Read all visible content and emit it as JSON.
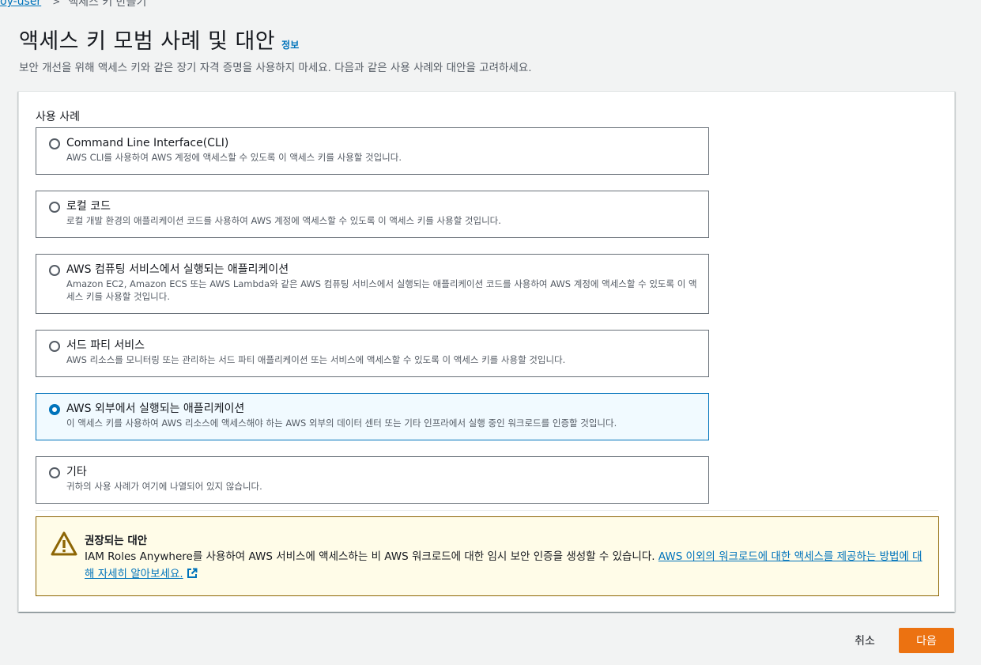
{
  "breadcrumb": {
    "user_link": "oy-user",
    "separator": ">",
    "current": "액세스 키 만들기"
  },
  "header": {
    "title": "액세스 키 모범 사례 및 대안",
    "info_link": "정보",
    "description": "보안 개선을 위해 액세스 키와 같은 장기 자격 증명을 사용하지 마세요. 다음과 같은 사용 사례와 대안을 고려하세요."
  },
  "use_cases": {
    "label": "사용 사례",
    "selected_index": 4,
    "options": [
      {
        "title": "Command Line Interface(CLI)",
        "description": "AWS CLI를 사용하여 AWS 계정에 액세스할 수 있도록 이 액세스 키를 사용할 것입니다."
      },
      {
        "title": "로컬 코드",
        "description": "로컬 개발 환경의 애플리케이션 코드를 사용하여 AWS 계정에 액세스할 수 있도록 이 액세스 키를 사용할 것입니다."
      },
      {
        "title": "AWS 컴퓨팅 서비스에서 실행되는 애플리케이션",
        "description": "Amazon EC2, Amazon ECS 또는 AWS Lambda와 같은 AWS 컴퓨팅 서비스에서 실행되는 애플리케이션 코드를 사용하여 AWS 계정에 액세스할 수 있도록 이 액세스 키를 사용할 것입니다."
      },
      {
        "title": "서드 파티 서비스",
        "description": "AWS 리소스를 모니터링 또는 관리하는 서드 파티 애플리케이션 또는 서비스에 액세스할 수 있도록 이 액세스 키를 사용할 것입니다."
      },
      {
        "title": "AWS 외부에서 실행되는 애플리케이션",
        "description": "이 액세스 키를 사용하여 AWS 리소스에 액세스해야 하는 AWS 외부의 데이터 센터 또는 기타 인프라에서 실행 중인 워크로드를 인증할 것입니다."
      },
      {
        "title": "기타",
        "description": "귀하의 사용 사례가 여기에 나열되어 있지 않습니다."
      }
    ]
  },
  "alert": {
    "icon": "warning-icon",
    "title": "권장되는 대안",
    "body": "IAM Roles Anywhere를 사용하여 AWS 서비스에 액세스하는 비 AWS 워크로드에 대한 임시 보안 인증을 생성할 수 있습니다. ",
    "link_text": "AWS 이외의 워크로드에 대한 액세스를 제공하는 방법에 대해 자세히 알아보세요."
  },
  "footer": {
    "cancel_label": "취소",
    "next_label": "다음"
  },
  "colors": {
    "primary": "#ec7211",
    "link": "#0073bb",
    "selected_bg": "#f1faff",
    "warning_bg": "#fffce8",
    "warning_border": "#8d6605"
  }
}
